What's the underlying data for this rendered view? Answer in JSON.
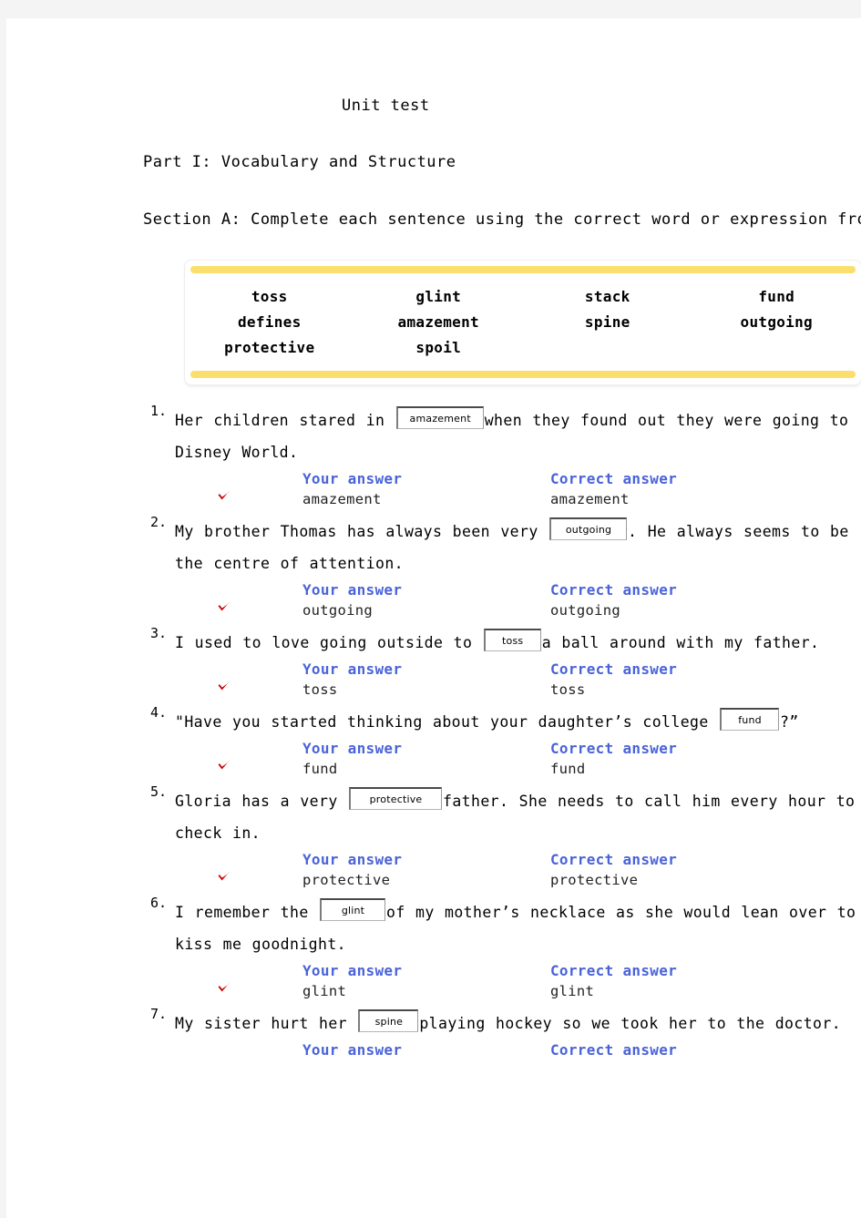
{
  "document": {
    "title": "Unit test",
    "part_heading": "Part I: Vocabulary and Structure",
    "section_heading": "Section A: Complete each sentence using the correct word or expression from the box"
  },
  "word_bank": {
    "rows": [
      [
        "toss",
        "glint",
        "stack",
        "fund"
      ],
      [
        "defines",
        "amazement",
        "spine",
        "outgoing"
      ],
      [
        "protective",
        "spoil",
        "",
        ""
      ]
    ],
    "accent_color": "#fadf6e"
  },
  "labels": {
    "your_answer": "Your answer",
    "correct_answer": "Correct answer",
    "check_mark": "check-mark",
    "correct_color": "#cc0000",
    "heading_color": "#4a63d8"
  },
  "questions": [
    {
      "number": "1.",
      "before": "Her children stared in ",
      "input_value": "amazement",
      "input_width": 96,
      "after": "when they found out they were going to Disney World.",
      "your_answer": "amazement",
      "correct_answer": "amazement",
      "is_correct": true,
      "answered": true
    },
    {
      "number": "2.",
      "before": "My brother Thomas has always been very ",
      "input_value": "outgoing",
      "input_width": 85,
      "after": ". He always seems to be the centre of attention.",
      "your_answer": "outgoing",
      "correct_answer": "outgoing",
      "is_correct": true,
      "answered": true
    },
    {
      "number": "3.",
      "before": "I used to love going outside to ",
      "input_value": "toss",
      "input_width": 63,
      "after": "a ball around with my father.",
      "your_answer": "toss",
      "correct_answer": "toss",
      "is_correct": true,
      "answered": true
    },
    {
      "number": "4.",
      "before": "\"Have you started thinking about your daughter’s college ",
      "input_value": "fund",
      "input_width": 65,
      "after": "?”",
      "your_answer": "fund",
      "correct_answer": "fund",
      "is_correct": true,
      "answered": true
    },
    {
      "number": "5.",
      "before": "Gloria has a very ",
      "input_value": "protective",
      "input_width": 102,
      "after": "father. She needs to call him every hour to check in.",
      "your_answer": "protective",
      "correct_answer": "protective",
      "is_correct": true,
      "answered": true
    },
    {
      "number": "6.",
      "before": "I remember the ",
      "input_value": "glint",
      "input_width": 72,
      "after": "of my mother’s necklace as she would lean over to kiss me goodnight.",
      "your_answer": "glint",
      "correct_answer": "glint",
      "is_correct": true,
      "answered": true
    },
    {
      "number": "7.",
      "before": "My sister hurt her ",
      "input_value": "spine",
      "input_width": 66,
      "after": "playing hockey so we took her to the doctor.",
      "your_answer": "",
      "correct_answer": "",
      "is_correct": false,
      "answered": false
    }
  ]
}
